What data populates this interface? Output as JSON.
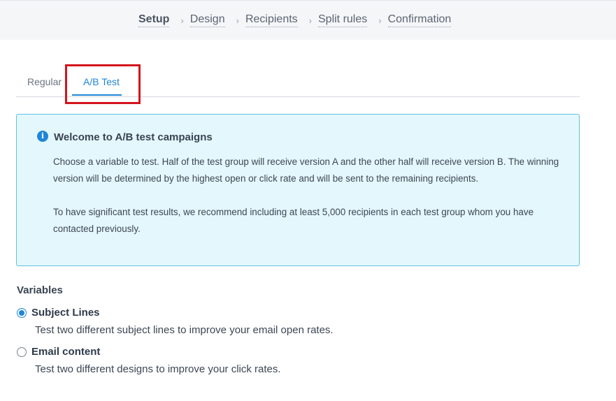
{
  "stepper": {
    "steps": [
      {
        "label": "Setup",
        "active": true
      },
      {
        "label": "Design",
        "active": false
      },
      {
        "label": "Recipients",
        "active": false
      },
      {
        "label": "Split rules",
        "active": false
      },
      {
        "label": "Confirmation",
        "active": false
      }
    ],
    "separator": "›"
  },
  "tabs": {
    "regular": "Regular",
    "ab_test": "A/B Test",
    "active": "ab_test"
  },
  "info": {
    "icon": "info-circle-icon",
    "icon_glyph": "i",
    "title": "Welcome to A/B test campaigns",
    "paragraph_1": "Choose a variable to test. Half of the test group will receive version A and the other half will receive version B. The winning version will be determined by the highest open or click rate and will be sent to the remaining recipients.",
    "paragraph_2": "To have significant test results, we recommend including at least 5,000 recipients in each test group whom you have contacted previously."
  },
  "variables": {
    "heading": "Variables",
    "options": [
      {
        "label": "Subject Lines",
        "description": "Test two different subject lines to improve your email open rates.",
        "checked": true
      },
      {
        "label": "Email content",
        "description": "Test two different designs to improve your click rates.",
        "checked": false
      }
    ]
  },
  "colors": {
    "accent": "#1f86d8",
    "highlight": "#d4141c",
    "info_bg": "#e4f7fc",
    "info_border": "#5cc3e0"
  }
}
